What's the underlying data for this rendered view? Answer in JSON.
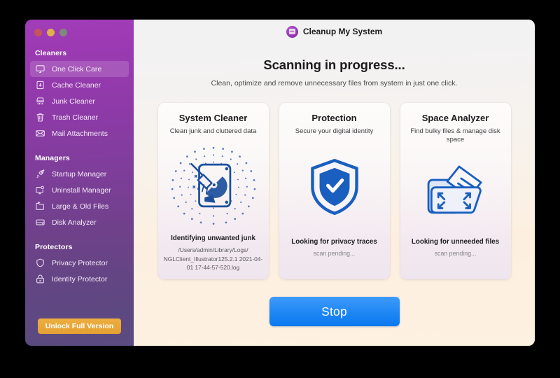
{
  "window": {
    "traffic_lights": [
      "close",
      "minimize",
      "zoom"
    ],
    "app_title": "Cleanup My System",
    "logo_icon": "cleanup-logo-icon"
  },
  "sidebar": {
    "sections": [
      {
        "title": "Cleaners",
        "items": [
          {
            "label": "One Click Care",
            "icon": "monitor-icon",
            "active": true
          },
          {
            "label": "Cache Cleaner",
            "icon": "cache-box-icon",
            "active": false
          },
          {
            "label": "Junk Cleaner",
            "icon": "brush-icon",
            "active": false
          },
          {
            "label": "Trash Cleaner",
            "icon": "trash-can-icon",
            "active": false
          },
          {
            "label": "Mail Attachments",
            "icon": "envelope-icon",
            "active": false
          }
        ]
      },
      {
        "title": "Managers",
        "items": [
          {
            "label": "Startup Manager",
            "icon": "rocket-icon",
            "active": false
          },
          {
            "label": "Uninstall Manager",
            "icon": "monitor-gear-icon",
            "active": false
          },
          {
            "label": "Large & Old Files",
            "icon": "folder-clock-icon",
            "active": false
          },
          {
            "label": "Disk Analyzer",
            "icon": "hard-drive-icon",
            "active": false
          }
        ]
      },
      {
        "title": "Protectors",
        "items": [
          {
            "label": "Privacy Protector",
            "icon": "shield-icon",
            "active": false
          },
          {
            "label": "Identity Protector",
            "icon": "lock-icon",
            "active": false
          }
        ]
      }
    ],
    "unlock_label": "Unlock Full Version"
  },
  "main": {
    "headline": "Scanning in progress...",
    "subhead": "Clean, optimize and remove unnecessary files from system in just one click.",
    "cards": [
      {
        "title": "System Cleaner",
        "subtitle": "Clean junk and cluttered data",
        "art_icon": "disk-broom-scan-icon",
        "status": "Identifying unwanted junk",
        "detail": "/Users/admin/Library/Logs/ NGLClient_Illustrator125.2.1 2021-04-01 17-44-57-520.log",
        "pending": false
      },
      {
        "title": "Protection",
        "subtitle": "Secure your digital identity",
        "art_icon": "shield-check-icon",
        "status": "Looking for privacy traces",
        "detail": "scan pending...",
        "pending": true
      },
      {
        "title": "Space Analyzer",
        "subtitle": "Find bulky files & manage disk space",
        "art_icon": "folder-expand-icon",
        "status": "Looking for unneeded files",
        "detail": "scan pending...",
        "pending": true
      }
    ],
    "stop_label": "Stop"
  },
  "colors": {
    "sidebar_top": "#a13cb8",
    "sidebar_bottom": "#5a4b80",
    "accent_blue": "#1a86f2",
    "unlock_orange": "#e5a033",
    "icon_navy": "#1b4f9c"
  }
}
